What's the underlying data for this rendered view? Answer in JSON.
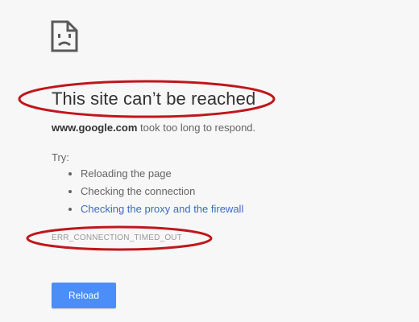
{
  "icon": "sad-document-icon",
  "title": "This site can’t be reached",
  "description": {
    "host": "www.google.com",
    "message": " took too long to respond."
  },
  "try_label": "Try:",
  "suggestions": [
    {
      "label": "Reloading the page",
      "is_link": false
    },
    {
      "label": "Checking the connection",
      "is_link": false
    },
    {
      "label": "Checking the proxy and the firewall",
      "is_link": true
    }
  ],
  "error_code": "ERR_CONNECTION_TIMED_OUT",
  "reload_button": {
    "label": "Reload"
  },
  "colors": {
    "background": "#f7f7f7",
    "button": "#4c8ef7",
    "link": "#3b6bbf",
    "annotation": "#c0161b"
  }
}
